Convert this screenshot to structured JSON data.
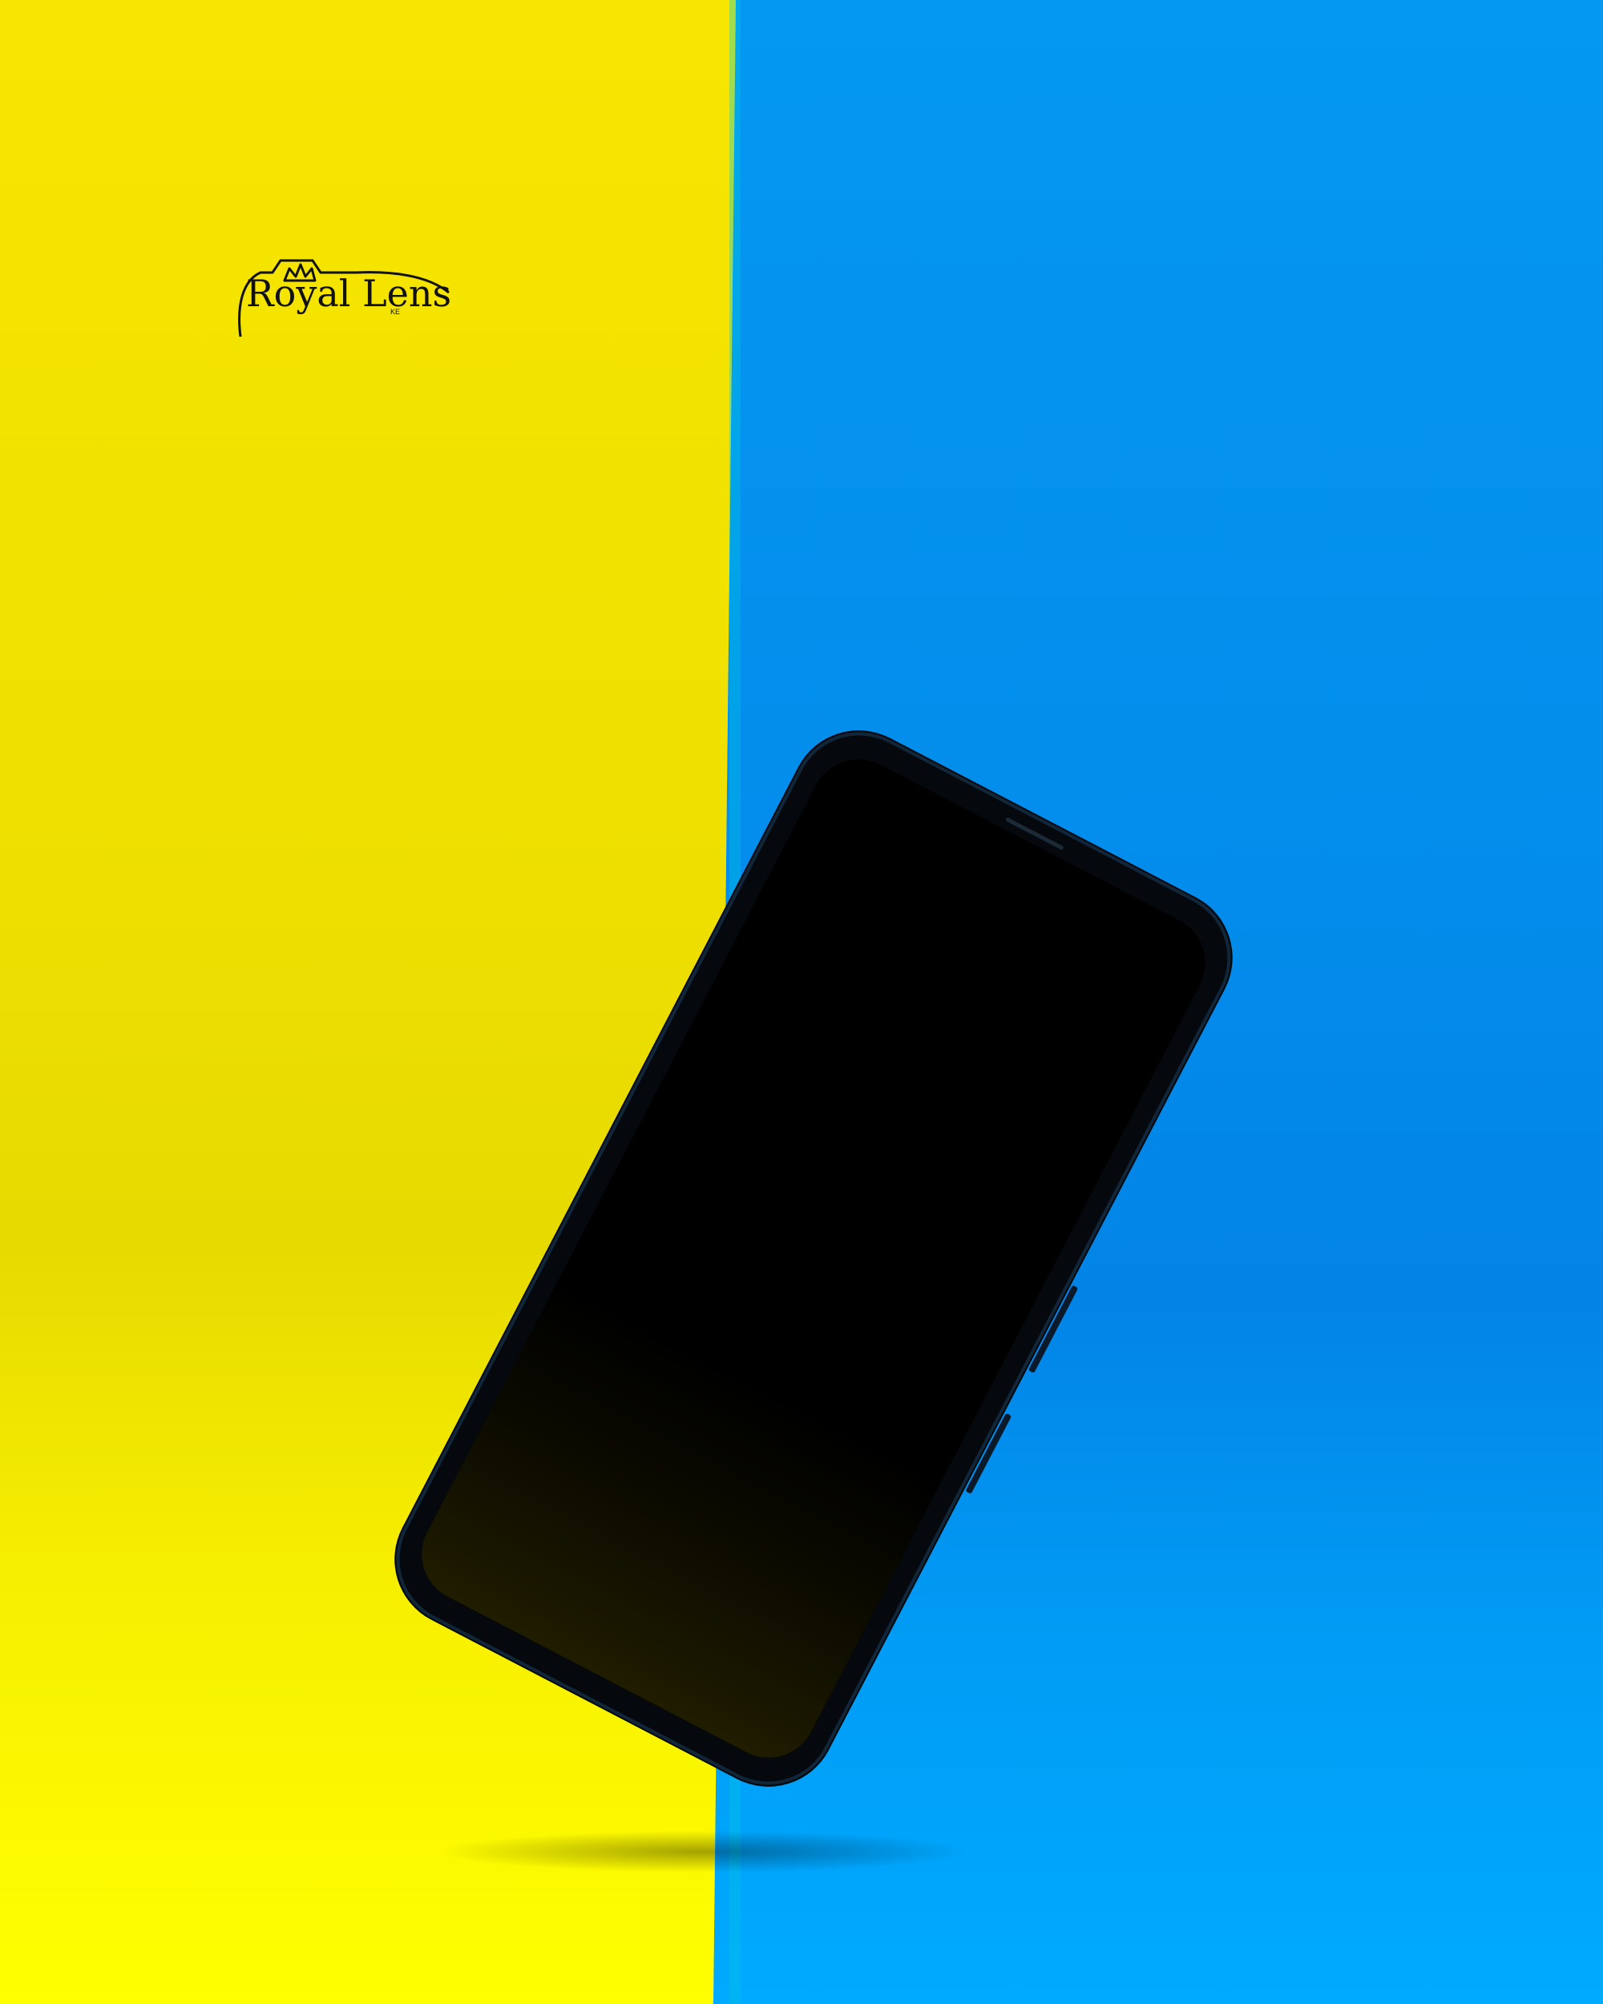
{
  "photo": {
    "subject": "smartphone",
    "watermark": {
      "brand_text": "Royal Lens",
      "suffix_text": "KE"
    },
    "colors": {
      "yellow_backdrop": "#F2E400",
      "blue_backdrop": "#0390EE",
      "phone_body": "#05080C",
      "phone_screen": "#000000",
      "watermark_ink": "#111111"
    }
  }
}
